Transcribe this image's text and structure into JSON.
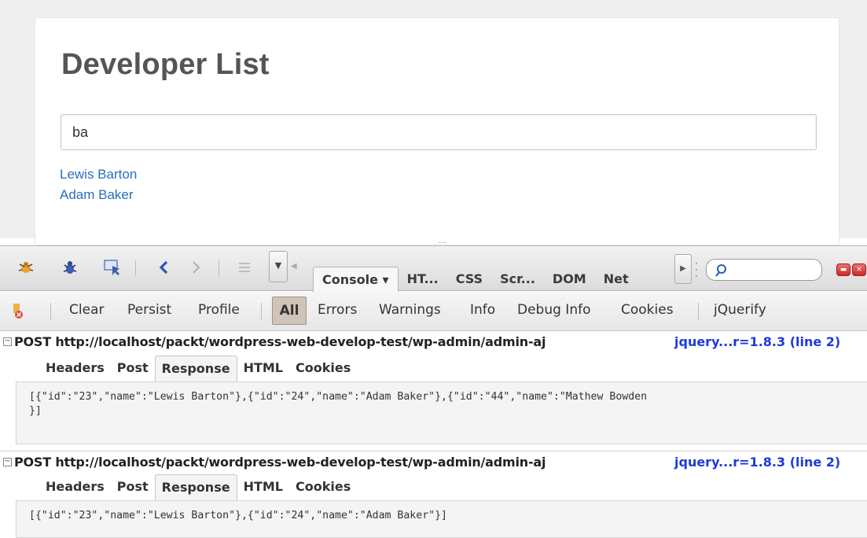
{
  "page": {
    "title": "Developer List",
    "search_value": "ba",
    "results": [
      "Lewis Barton",
      "Adam Baker"
    ]
  },
  "firebug": {
    "resize_grip": "…",
    "toolbar": {
      "panel_menu": "▼",
      "tabs": [
        "Console ▾",
        "HT...",
        "CSS",
        "Scr...",
        "DOM",
        "Net"
      ],
      "search_value": "",
      "search_icon": "magnifier-icon",
      "icons": [
        "firebug-icon",
        "inspect-bug-icon",
        "inspect-element-icon",
        "back-icon",
        "forward-icon",
        "list-icon",
        "close-icon",
        "detach-icon"
      ]
    },
    "subbar": {
      "items": [
        "Clear",
        "Persist",
        "Profile",
        "All",
        "Errors",
        "Warnings",
        "Info",
        "Debug Info",
        "Cookies",
        "jQuerify"
      ]
    },
    "logs": [
      {
        "method_url": "POST http://localhost/packt/wordpress-web-develop-test/wp-admin/admin-aj",
        "source": "jquery...r=1.8.3 (line 2)",
        "tabs": [
          "Headers",
          "Post",
          "Response",
          "HTML",
          "Cookies"
        ],
        "response": "[{\"id\":\"23\",\"name\":\"Lewis Barton\"},{\"id\":\"24\",\"name\":\"Adam Baker\"},{\"id\":\"44\",\"name\":\"Mathew Bowden\n}]"
      },
      {
        "method_url": "POST http://localhost/packt/wordpress-web-develop-test/wp-admin/admin-aj",
        "source": "jquery...r=1.8.3 (line 2)",
        "tabs": [
          "Headers",
          "Post",
          "Response",
          "HTML",
          "Cookies"
        ],
        "response": "[{\"id\":\"23\",\"name\":\"Lewis Barton\"},{\"id\":\"24\",\"name\":\"Adam Baker\"}]"
      }
    ]
  }
}
